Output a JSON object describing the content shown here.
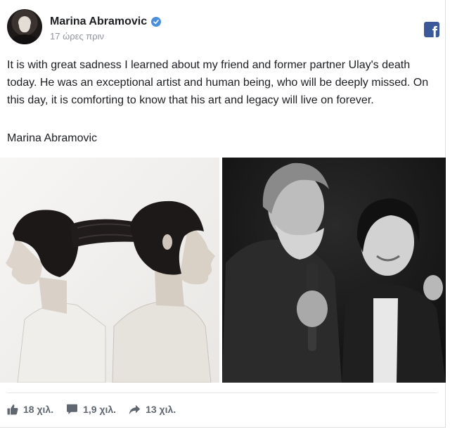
{
  "post": {
    "author": "Marina Abramovic",
    "time": "17 ώρες πριν",
    "text": "It is with great sadness I learned about my friend and former partner Ulay's death today. He was an exceptional artist and human being, who will be deeply missed. On this day, it is comforting to know that his art and legacy will live on forever.",
    "signature": "Marina Abramovic"
  },
  "icons": {
    "verified": "verified-badge-icon",
    "brand": "facebook-logo-icon",
    "like": "thumbs-up-icon",
    "comment": "comment-bubble-icon",
    "share": "share-arrow-icon"
  },
  "stats": {
    "likes": "18 χιλ.",
    "comments": "1,9 χιλ.",
    "shares": "13 χιλ."
  },
  "colors": {
    "brand": "#3b5998",
    "verified": "#4a90d9",
    "meta_text": "#90949c",
    "action_text": "#606770"
  }
}
